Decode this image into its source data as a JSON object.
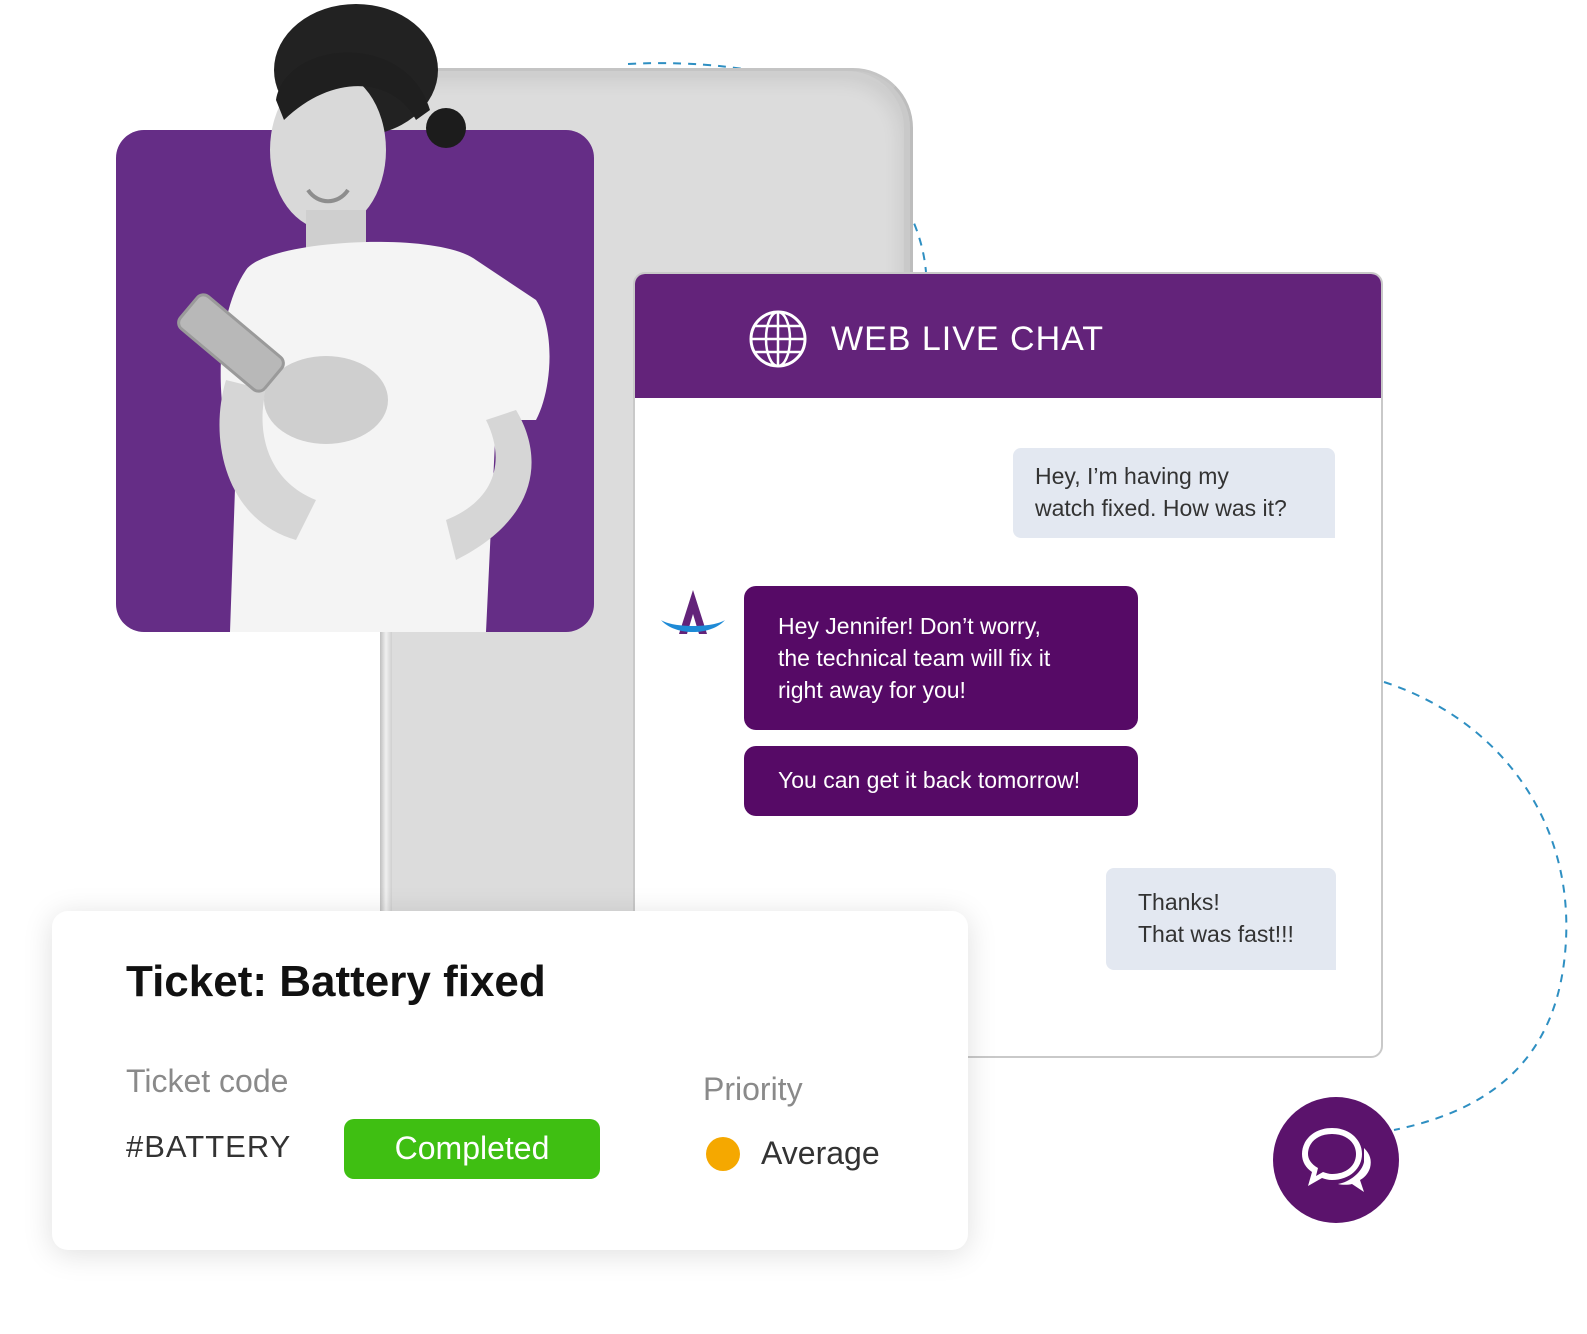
{
  "chat": {
    "title": "WEB LIVE CHAT",
    "header_icon": "globe-icon",
    "agent_icon": "brand-a-logo",
    "messages": [
      {
        "from": "user",
        "text": "Hey, I’m having my\nwatch fixed. How was it?"
      },
      {
        "from": "agent",
        "text": "Hey Jennifer! Don’t worry,\nthe technical team will fix it\nright away for you!"
      },
      {
        "from": "agent",
        "text": "You can get it back tomorrow!"
      },
      {
        "from": "user",
        "text": "Thanks!\nThat was fast!!!"
      }
    ]
  },
  "ticket": {
    "title": "Ticket: Battery fixed",
    "code_label": "Ticket code",
    "code_value": "#BATTERY",
    "status": "Completed",
    "priority_label": "Priority",
    "priority_value": "Average"
  },
  "fab": {
    "icon": "chat-bubbles-icon"
  },
  "colors": {
    "brand_purple": "#63237a",
    "photo_purple": "#652d86",
    "agent_bubble": "#560a66",
    "user_bubble": "#e3e8f1",
    "status_green": "#3fbf12",
    "priority_dot": "#f5a800",
    "connector_blue": "#2e8fc2"
  }
}
